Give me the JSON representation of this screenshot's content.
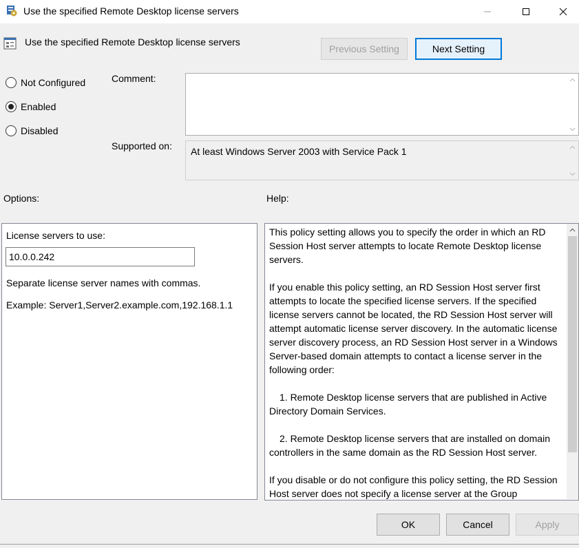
{
  "window": {
    "title": "Use the specified Remote Desktop license servers",
    "controls": {
      "minimize": "minimize",
      "maximize": "maximize",
      "close": "close"
    }
  },
  "header": {
    "setting_title": "Use the specified Remote Desktop license servers",
    "previous_label": "Previous Setting",
    "next_label": "Next Setting"
  },
  "state": {
    "options": [
      {
        "label": "Not Configured",
        "checked": false
      },
      {
        "label": "Enabled",
        "checked": true
      },
      {
        "label": "Disabled",
        "checked": false
      }
    ]
  },
  "comment": {
    "label": "Comment:",
    "value": ""
  },
  "supported": {
    "label": "Supported on:",
    "value": "At least Windows Server 2003 with Service Pack 1"
  },
  "options_panel": {
    "heading": "Options:",
    "field_label": "License servers to use:",
    "field_value": "10.0.0.242",
    "hint": "Separate license server names with commas.",
    "example": "Example: Server1,Server2.example.com,192.168.1.1"
  },
  "help_panel": {
    "heading": "Help:",
    "paragraphs": [
      "This policy setting allows you to specify the order in which an RD Session Host server attempts to locate Remote Desktop license servers.",
      "If you enable this policy setting, an RD Session Host server first attempts to locate the specified license servers. If the specified license servers cannot be located, the RD Session Host server will attempt automatic license server discovery. In the automatic license server discovery process, an RD Session Host server in a Windows Server-based domain attempts to contact a license server in the following order:",
      "1. Remote Desktop license servers that are published in Active Directory Domain Services.",
      "2. Remote Desktop license servers that are installed on domain controllers in the same domain as the RD Session Host server.",
      "If you disable or do not configure this policy setting, the RD Session Host server does not specify a license server at the Group"
    ]
  },
  "footer": {
    "ok_label": "OK",
    "cancel_label": "Cancel",
    "apply_label": "Apply"
  },
  "colors": {
    "accent": "#0078d7",
    "dialog_bg": "#f0f0f0"
  }
}
